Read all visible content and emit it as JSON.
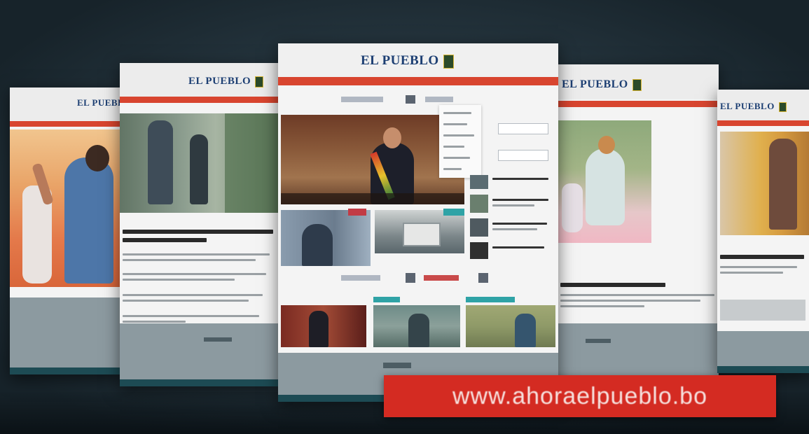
{
  "brand": {
    "logo_text": "EL PUEBLO",
    "website": "www.ahoraelpueblo.bo"
  },
  "colors": {
    "background": "#2a3b45",
    "header_red": "#d8452f",
    "banner_red": "#d42b22",
    "logo_blue": "#1d3f73",
    "footer_teal": "#1d4b54"
  },
  "pages": [
    {
      "id": "far-left",
      "logo": "EL PUEBLO"
    },
    {
      "id": "left",
      "logo": "EL PUEBLO"
    },
    {
      "id": "center",
      "logo": "EL PUEBLO"
    },
    {
      "id": "right",
      "logo": "EL PUEBLO"
    },
    {
      "id": "far-right",
      "logo": "EL PUEBLO"
    }
  ]
}
